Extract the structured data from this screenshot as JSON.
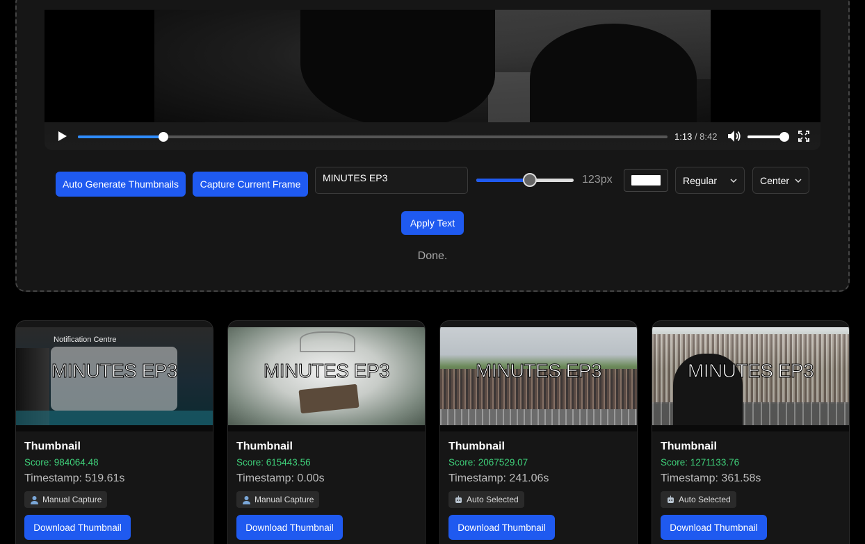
{
  "player": {
    "current_time": "1:13",
    "total_time": "8:42",
    "progress_percent": 14.5,
    "volume_percent": 92
  },
  "toolbar": {
    "auto_label": "Auto Generate Thumbnails",
    "capture_label": "Capture Current Frame",
    "text_value": "MINUTES EP3",
    "font_size_label": "123px",
    "font_size_slider_percent": 55,
    "text_color": "#ffffff",
    "font_weight_selected": "Regular",
    "alignment_selected": "Center",
    "apply_label": "Apply Text"
  },
  "status": "Done.",
  "colors": {
    "accent": "#1f5af0",
    "score": "#3fd07a"
  },
  "cards": [
    {
      "overlay_text": "MINUTES EP3",
      "title": "Thumbnail",
      "score": "Score: 984064.48",
      "timestamp": "Timestamp: 519.61s",
      "badge_icon": "user-icon",
      "badge": "Manual Capture",
      "download_label": "Download Thumbnail",
      "notif_title": "Notification Centre"
    },
    {
      "overlay_text": "MINUTES EP3",
      "title": "Thumbnail",
      "score": "Score: 615443.56",
      "timestamp": "Timestamp: 0.00s",
      "badge_icon": "user-icon",
      "badge": "Manual Capture",
      "download_label": "Download Thumbnail"
    },
    {
      "overlay_text": "MINUTES EP3",
      "title": "Thumbnail",
      "score": "Score: 2067529.07",
      "timestamp": "Timestamp: 241.06s",
      "badge_icon": "robot-icon",
      "badge": "Auto Selected",
      "download_label": "Download Thumbnail"
    },
    {
      "overlay_text": "MINUTES EP3",
      "title": "Thumbnail",
      "score": "Score: 1271133.76",
      "timestamp": "Timestamp: 361.58s",
      "badge_icon": "robot-icon",
      "badge": "Auto Selected",
      "download_label": "Download Thumbnail"
    }
  ]
}
